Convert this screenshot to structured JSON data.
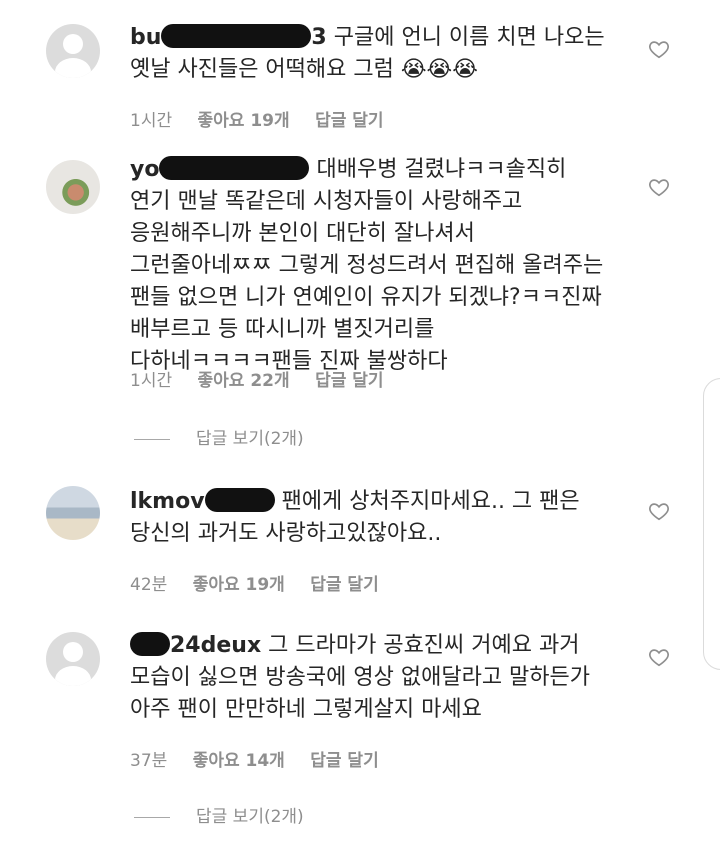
{
  "comments": [
    {
      "username": "bu",
      "username_suffix": "3",
      "text": "구글에 언니 이름 치면 나오는 옛날 사진들은 어떡해요 그럼 😭😭😭",
      "time": "1시간",
      "likes": "좋아요 19개",
      "reply": "답글 달기"
    },
    {
      "username": "yo",
      "text": "대배우병 걸렸냐ㅋㅋ솔직히 연기 맨날 똑같은데 시청자들이 사랑해주고 응원해주니까 본인이 대단히 잘나셔서 그런줄아네ㅉㅉ 그렇게 정성드려서 편집해 올려주는 팬들 없으면 니가 연예인이 유지가 되겠냐?ㅋㅋ진짜 배부르고 등 따시니까 별짓거리를 다하네ㅋㅋㅋㅋ팬들 진짜 불쌍하다",
      "time": "1시간",
      "likes": "좋아요 22개",
      "reply": "답글 달기",
      "view_replies": "답글 보기(2개)"
    },
    {
      "username": "lkmov",
      "text": "팬에게 상처주지마세요.. 그 팬은 당신의 과거도 사랑하고있잖아요..",
      "time": "42분",
      "likes": "좋아요 19개",
      "reply": "답글 달기"
    },
    {
      "username": "24deux",
      "text": "그 드라마가 공효진씨 거예요 과거 모습이 싫으면 방송국에 영상 없애달라고 말하든가 아주 팬이 만만하네 그렇게살지 마세요",
      "time": "37분",
      "likes": "좋아요 14개",
      "reply": "답글 달기",
      "view_replies": "답글 보기(2개)"
    }
  ],
  "icons": {
    "like": "heart-outline-icon",
    "avatar_default": "default-avatar-icon"
  },
  "colors": {
    "text": "#262626",
    "meta": "#8e8e8e",
    "divider": "#a8a8a8"
  }
}
